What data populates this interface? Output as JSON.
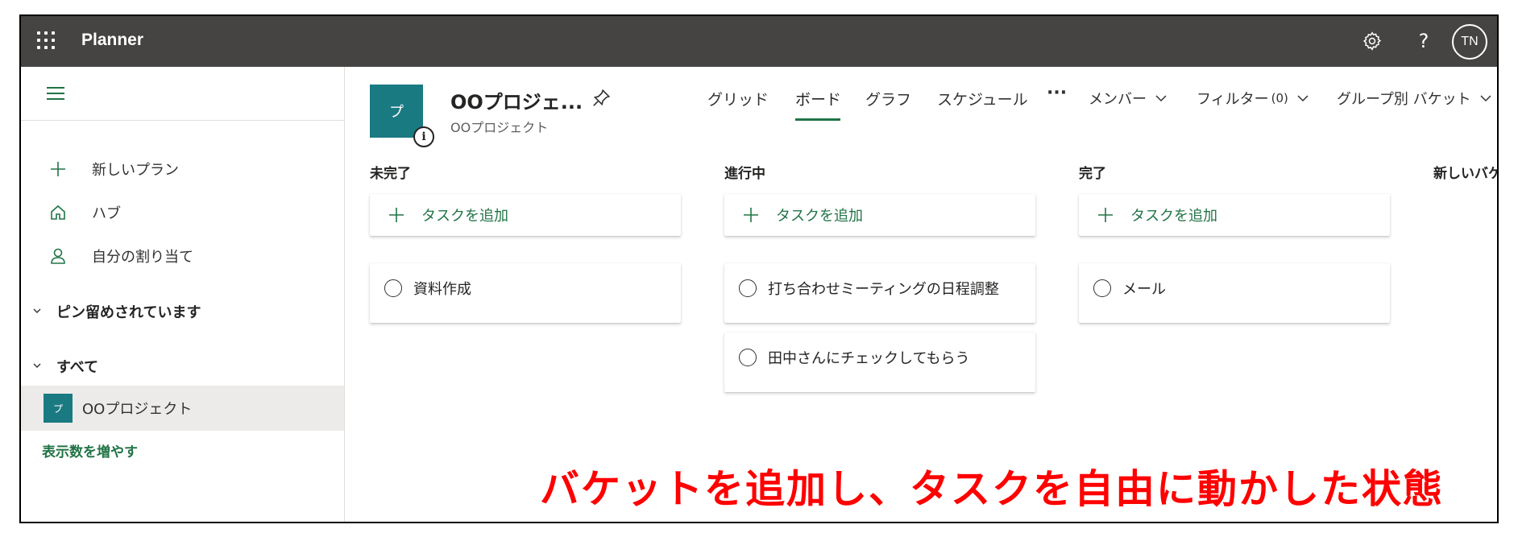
{
  "topbar": {
    "app_name": "Planner",
    "avatar_initials": "TN",
    "settings_icon": "gear-icon",
    "help_icon": "?",
    "background": "#464442"
  },
  "sidebar": {
    "menu_icon": "hamburger-icon",
    "items": [
      {
        "label": "新しいプラン",
        "icon": "plus-icon"
      },
      {
        "label": "ハブ",
        "icon": "home-icon"
      },
      {
        "label": "自分の割り当て",
        "icon": "person-icon"
      }
    ],
    "sections": [
      {
        "label": "ピン留めされています"
      },
      {
        "label": "すべて"
      }
    ],
    "plans": [
      {
        "tile_label": "プ",
        "label": "OOプロジェクト"
      }
    ],
    "show_more": "表示数を増やす"
  },
  "header": {
    "tile_label": "プ",
    "title": "OOプロジェ...",
    "subtitle": "OOプロジェクト",
    "tabs": [
      {
        "label": "グリッド",
        "active": false
      },
      {
        "label": "ボード",
        "active": true
      },
      {
        "label": "グラフ",
        "active": false
      },
      {
        "label": "スケジュール",
        "active": false
      }
    ],
    "more": "···",
    "members_label": "メンバー",
    "filter_label": "フィルター",
    "filter_count": "(0)",
    "group_label": "グループ別 バケット"
  },
  "board": {
    "add_task_label": "タスクを追加",
    "buckets": [
      {
        "name": "未完了",
        "tasks": [
          "資料作成"
        ]
      },
      {
        "name": "進行中",
        "tasks": [
          "打ち合わせミーティングの日程調整",
          "田中さんにチェックしてもらう"
        ]
      },
      {
        "name": "完了",
        "tasks": [
          "メール"
        ]
      }
    ],
    "new_bucket_label": "新しいバケ"
  },
  "annotation": "バケットを追加し、タスクを自由に動かした状態",
  "colors": {
    "accent": "#217346",
    "plan_tile": "#1a7a82",
    "annotation": "#ff0000"
  }
}
